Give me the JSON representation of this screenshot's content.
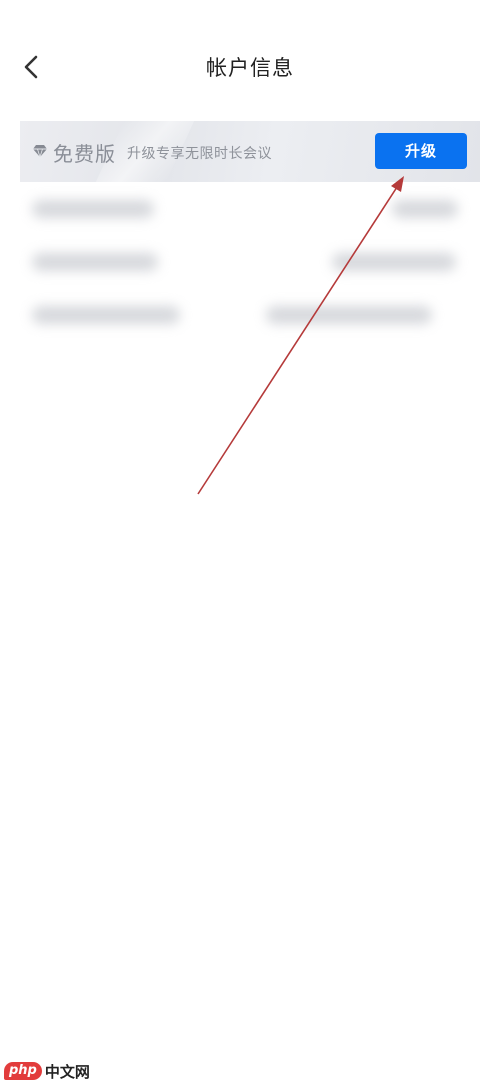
{
  "header": {
    "title": "帐户信息",
    "back_icon": "chevron-left-icon"
  },
  "plan_banner": {
    "plan_icon": "diamond-icon",
    "plan_name": "免费版",
    "description": "升级专享无限时长会议",
    "upgrade_label": "升级",
    "colors": {
      "button": "#0a72f0",
      "button_text": "#ffffff",
      "banner_bg": "#e6e8ec"
    }
  },
  "info_rows": [
    {
      "label": "",
      "value": "",
      "blurred": true
    },
    {
      "label": "",
      "value": "",
      "blurred": true
    },
    {
      "label": "",
      "value": "",
      "blurred": true
    }
  ],
  "annotation": {
    "type": "arrow",
    "color": "#b53a3a",
    "points_to": "upgrade-button"
  },
  "watermark": {
    "badge": "php",
    "site": "中文网"
  }
}
